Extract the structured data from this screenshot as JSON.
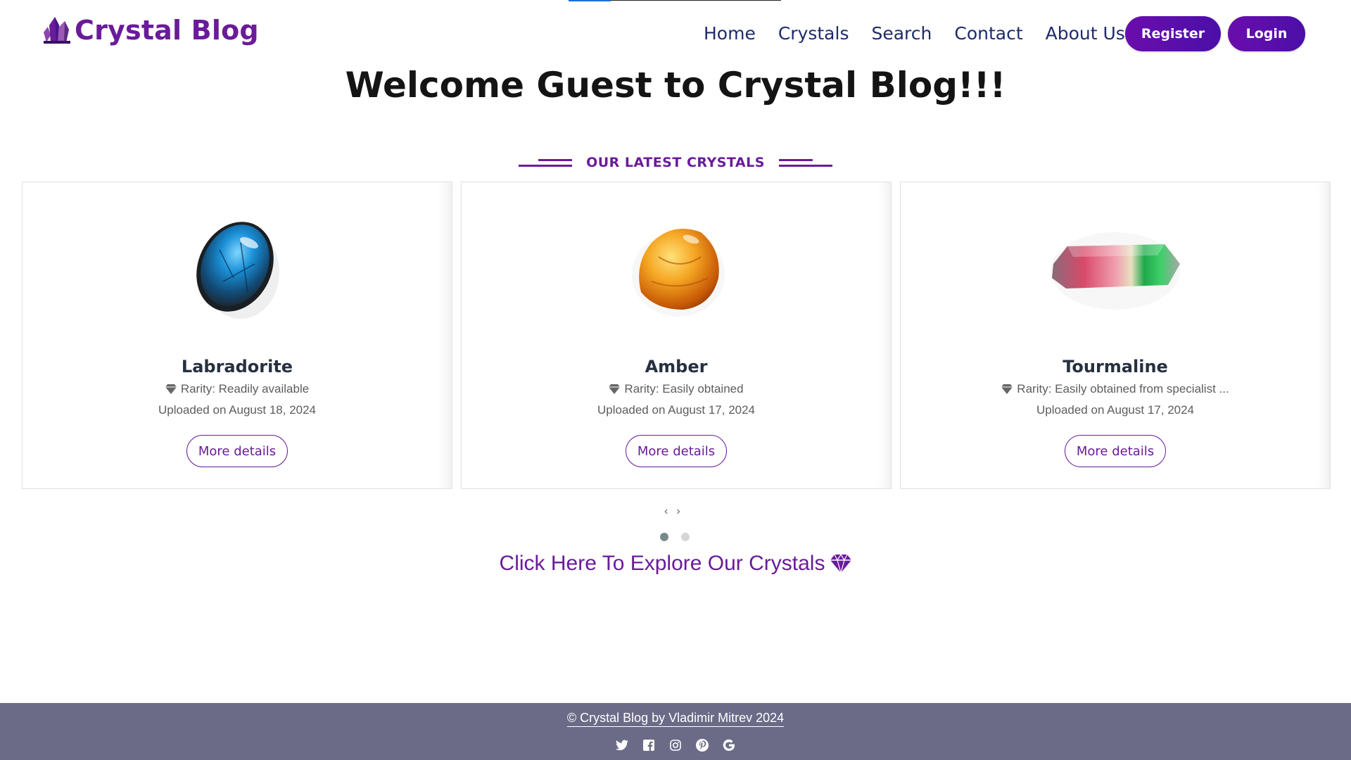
{
  "brand": {
    "name": "Crystal Blog",
    "icon": "crystal-cluster-icon"
  },
  "nav": {
    "items": [
      "Home",
      "Crystals",
      "Search",
      "Contact",
      "About Us"
    ]
  },
  "auth": {
    "register_label": "Register",
    "login_label": "Login"
  },
  "hero": {
    "title": "Welcome Guest to Crystal Blog!!!"
  },
  "section": {
    "title": "OUR LATEST CRYSTALS"
  },
  "cards": [
    {
      "name": "Labradorite",
      "rarity": "Rarity: Readily available",
      "date": "Uploaded on August 18, 2024",
      "button": "More details",
      "image": "labradorite-stone"
    },
    {
      "name": "Amber",
      "rarity": "Rarity: Easily obtained",
      "date": "Uploaded on August 17, 2024",
      "button": "More details",
      "image": "amber-stone"
    },
    {
      "name": "Tourmaline",
      "rarity": "Rarity: Easily obtained from specialist ...",
      "date": "Uploaded on August 17, 2024",
      "button": "More details",
      "image": "tourmaline-crystal"
    }
  ],
  "carousel": {
    "prev": "‹",
    "next": "›",
    "pages": 2,
    "active_page": 1
  },
  "explore": {
    "label": "Click Here To Explore Our Crystals",
    "icon": "gem-icon"
  },
  "footer": {
    "copyright": "© Crystal Blog by Vladimir Mitrev 2024",
    "socials": [
      "twitter-icon",
      "facebook-icon",
      "instagram-icon",
      "pinterest-icon",
      "google-icon"
    ]
  },
  "colors": {
    "brand": "#6a1b9a",
    "nav": "#1f2a6b",
    "footer": "#6b6b88"
  }
}
